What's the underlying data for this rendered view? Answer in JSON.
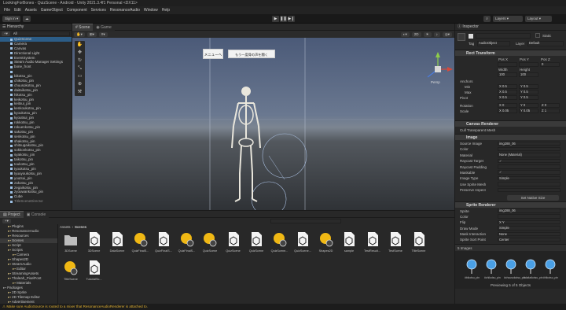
{
  "app": {
    "title": "LookingForBones - QuizScene - Android - Unity 2021.3.4f1 Personal <DX11>"
  },
  "menu": [
    "File",
    "Edit",
    "Assets",
    "GameObject",
    "Component",
    "Services",
    "ResonanceAudio",
    "Window",
    "Help"
  ],
  "toolbar": {
    "signin": "Sign in",
    "layers": "Layers",
    "layout": "Layout"
  },
  "hierarchy": {
    "title": "Hierarchy",
    "search_placeholder": "All",
    "items": [
      {
        "label": "QuizScene",
        "state": "selected"
      },
      {
        "label": "Camera",
        "state": "normal"
      },
      {
        "label": "Canvas",
        "state": "normal"
      },
      {
        "label": "Directional Light",
        "state": "normal"
      },
      {
        "label": "EventSystem",
        "state": "normal"
      },
      {
        "label": "Steam Audio Manager Settings",
        "state": "normal"
      },
      {
        "label": "bone_front",
        "state": "normal"
      },
      {
        "label": "",
        "state": "normal"
      },
      {
        "label": "bikotsu_pin",
        "state": "normal"
      },
      {
        "label": "chikotsu_pin",
        "state": "normal"
      },
      {
        "label": "chuusokotsu_pin",
        "state": "normal"
      },
      {
        "label": "daitaikotsu_pin",
        "state": "normal"
      },
      {
        "label": "hikotsu_pin",
        "state": "normal"
      },
      {
        "label": "keikotsu_pin",
        "state": "normal"
      },
      {
        "label": "keitsui_pin",
        "state": "normal"
      },
      {
        "label": "kenkoukotsu_pin",
        "state": "normal"
      },
      {
        "label": "kyoukotsu_pin",
        "state": "normal"
      },
      {
        "label": "kyoutsui_pin",
        "state": "normal"
      },
      {
        "label": "rokkotsu_pin",
        "state": "normal"
      },
      {
        "label": "rokuenkotsu_pin",
        "state": "normal"
      },
      {
        "label": "sakotsu_pin",
        "state": "normal"
      },
      {
        "label": "senkotsu_pin",
        "state": "normal"
      },
      {
        "label": "shakotsu_pin",
        "state": "normal"
      },
      {
        "label": "shitsugaikotsu_pin",
        "state": "normal"
      },
      {
        "label": "sokkonkotsu_pin",
        "state": "normal"
      },
      {
        "label": "syakotsu_pin",
        "state": "normal"
      },
      {
        "label": "taikotsu_pin",
        "state": "normal"
      },
      {
        "label": "toukotsu_pin",
        "state": "normal"
      },
      {
        "label": "tyoukotsu_pin",
        "state": "normal"
      },
      {
        "label": "tyuuyoukotsu_pin",
        "state": "normal"
      },
      {
        "label": "youtsui_pin",
        "state": "normal"
      },
      {
        "label": "zakotsu_pin",
        "state": "normal"
      },
      {
        "label": "zegaikotsu_pin",
        "state": "normal"
      },
      {
        "label": "zyouwankotsu_pin",
        "state": "normal"
      },
      {
        "label": "Cube",
        "state": "normal"
      },
      {
        "label": "TitleSceneDirector",
        "state": "dim"
      }
    ]
  },
  "scene": {
    "tabs": [
      {
        "label": "Scene",
        "active": true
      },
      {
        "label": "Game",
        "active": false
      }
    ],
    "ui_button": "メニューへ",
    "ui_text": "もう一度骨の声を聞く",
    "persp": "Persp"
  },
  "inspector": {
    "title": "Inspector",
    "object_name": "",
    "static_label": "Static",
    "tag_label": "Tag",
    "tag_value": "AudioObject",
    "layer_label": "Layer",
    "layer_value": "Default",
    "rect_transform": {
      "title": "Rect Transform",
      "pos_headers": [
        "Pos X",
        "Pos Y",
        "Pos Z"
      ],
      "pos_values": [
        "",
        "",
        "0"
      ],
      "size_headers": [
        "Width",
        "Height"
      ],
      "size_values": [
        "100",
        "100"
      ],
      "anchors_label": "Anchors",
      "min_label": "Min",
      "min": [
        "0.5",
        "0.5"
      ],
      "max_label": "Max",
      "max": [
        "0.5",
        "0.5"
      ],
      "pivot_label": "Pivot",
      "pivot": [
        "0.5",
        "0.5"
      ],
      "rotation_label": "Rotation",
      "rotation": [
        "0",
        "0",
        "0"
      ],
      "scale_label": "Scale",
      "scale": [
        "0.05",
        "0.05",
        "1"
      ]
    },
    "canvas_renderer": {
      "title": "Canvas Renderer",
      "cull_label": "Cull Transparent Mesh"
    },
    "image": {
      "title": "Image",
      "rows": [
        {
          "label": "Source Image",
          "value": "img288_06"
        },
        {
          "label": "Color",
          "value": ""
        },
        {
          "label": "Material",
          "value": "None (Material)"
        },
        {
          "label": "Raycast Target",
          "value": "✓"
        },
        {
          "label": "Raycast Padding",
          "value": ""
        },
        {
          "label": "Maskable",
          "value": "✓"
        },
        {
          "label": "Image Type",
          "value": "Simple"
        },
        {
          "label": "Use Sprite Mesh",
          "value": ""
        },
        {
          "label": "Preserve Aspect",
          "value": ""
        }
      ],
      "native_button": "Set Native Size"
    },
    "sprite_renderer": {
      "title": "Sprite Renderer",
      "rows": [
        {
          "label": "Sprite",
          "value": "img288_06"
        },
        {
          "label": "Color",
          "value": ""
        },
        {
          "label": "Flip",
          "value": "X   Y"
        },
        {
          "label": "Draw Mode",
          "value": "Simple"
        },
        {
          "label": "Mask Interaction",
          "value": "None"
        },
        {
          "label": "Sprite Sort Point",
          "value": "Center"
        }
      ]
    },
    "images_label": "5 Images",
    "previews": [
      "#bikotsu_pin",
      "#chikotsu_pin",
      "#chuusokotsu_pin",
      "#daitaikotsu_pin",
      "#hikotsu_pin"
    ],
    "previewing": "Previewing 5 of 5 Objects"
  },
  "project": {
    "tabs": [
      {
        "label": "Project",
        "active": true
      },
      {
        "label": "Console",
        "active": false
      }
    ],
    "breadcrumb": [
      "Assets",
      "Scenes"
    ],
    "tree": [
      {
        "label": "Plugins",
        "indent": 1
      },
      {
        "label": "ResonanceAudio",
        "indent": 1
      },
      {
        "label": "Resources",
        "indent": 1
      },
      {
        "label": "Scenes",
        "indent": 1,
        "selected": true
      },
      {
        "label": "Script",
        "indent": 1
      },
      {
        "label": "Scripts",
        "indent": 1
      },
      {
        "label": "Camera",
        "indent": 2
      },
      {
        "label": "Shapes2D",
        "indent": 1
      },
      {
        "label": "SteamAudio",
        "indent": 1
      },
      {
        "label": "Editor",
        "indent": 2
      },
      {
        "label": "StreamingAssets",
        "indent": 1
      },
      {
        "label": "Thaleah_PixelFont",
        "indent": 1
      },
      {
        "label": "Materials",
        "indent": 2
      },
      {
        "label": "Packages",
        "indent": 0
      },
      {
        "label": "2D Sprite",
        "indent": 1
      },
      {
        "label": "2D Tilemap Editor",
        "indent": 1
      },
      {
        "label": "Advertisement",
        "indent": 1
      }
    ],
    "assets": [
      {
        "label": "3DScene",
        "type": "folder"
      },
      {
        "label": "3DScene",
        "type": "unity"
      },
      {
        "label": "DataScene",
        "type": "unity"
      },
      {
        "label": "QuizFinalS...",
        "type": "light"
      },
      {
        "label": "QuizFinalS...",
        "type": "unity"
      },
      {
        "label": "QuizFinalS...",
        "type": "light"
      },
      {
        "label": "QuizScene",
        "type": "light"
      },
      {
        "label": "QuizScene",
        "type": "unity"
      },
      {
        "label": "QuizScene",
        "type": "unity"
      },
      {
        "label": "QuizScene...",
        "type": "light"
      },
      {
        "label": "QuizScene...",
        "type": "unity"
      },
      {
        "label": "Shapes2D",
        "type": "light"
      },
      {
        "label": "sample",
        "type": "unity"
      },
      {
        "label": "TestResult...",
        "type": "unity"
      },
      {
        "label": "TestScene",
        "type": "unity"
      },
      {
        "label": "TitleScene",
        "type": "unity"
      },
      {
        "label": "TitleScene",
        "type": "light"
      },
      {
        "label": "TutorialSc...",
        "type": "unity"
      }
    ]
  },
  "status": {
    "message": "Make sure AudioSource is routed to a mixer that ResonanceAudioRenderer is attached to."
  },
  "colors": {
    "selection": "#2c5d87",
    "warning": "#e0b030",
    "lighting_icon": "#f0b814"
  }
}
